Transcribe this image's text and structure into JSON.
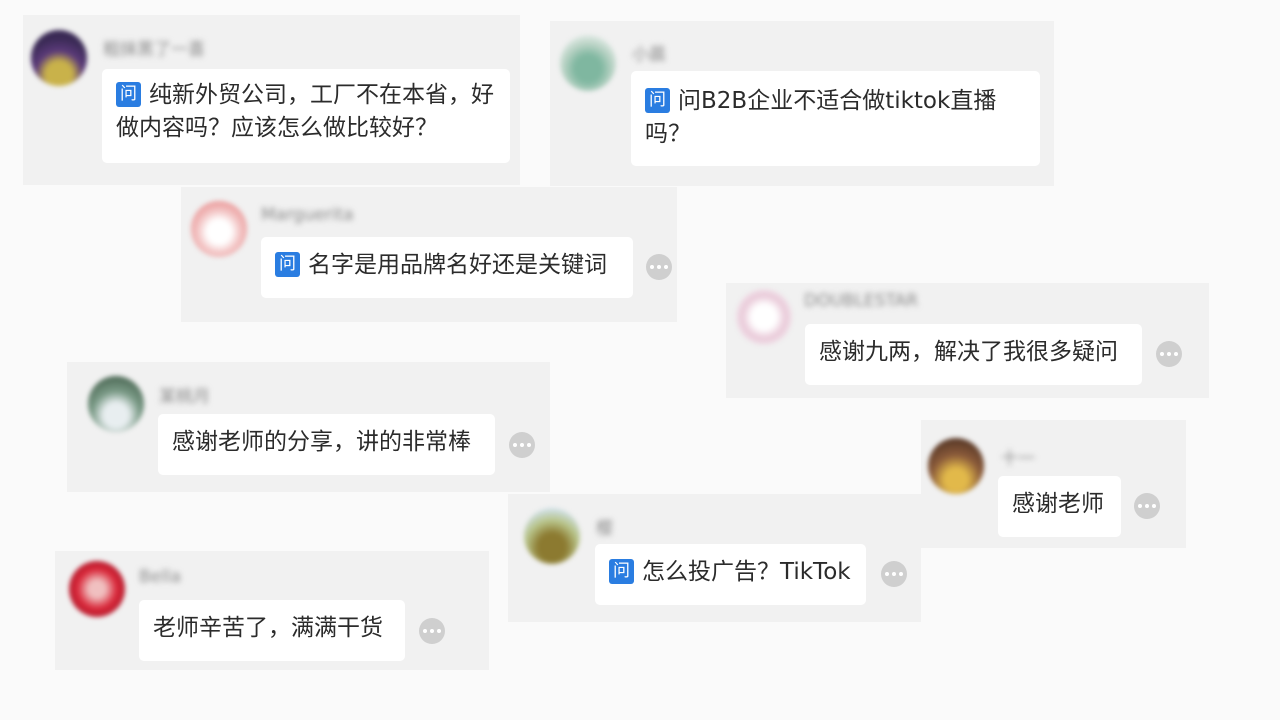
{
  "badge_label": "问",
  "comments": [
    {
      "username": "粗抹黑了一喜",
      "text": "纯新外贸公司，工厂不在本省，好做内容吗？应该怎么做比较好？",
      "is_question": true
    },
    {
      "username": "小晨",
      "text": "问B2B企业不适合做tiktok直播吗？",
      "is_question": false
    },
    {
      "username": "Marguerita",
      "text": "名字是用品牌名好还是关键词",
      "is_question": true
    },
    {
      "username": "DOUBLESTAR",
      "text": "感谢九两，解决了我很多疑问",
      "is_question": false
    },
    {
      "username": "某桃月",
      "text": "感谢老师的分享，讲的非常棒",
      "is_question": false
    },
    {
      "username": "十一",
      "text": "感谢老师",
      "is_question": false
    },
    {
      "username": "樱",
      "text": "怎么投广告？TikTok",
      "is_question": true
    },
    {
      "username": "Bella",
      "text": "老师辛苦了，满满干货",
      "is_question": false
    }
  ],
  "colors": {
    "badge": "#2a7de1",
    "card": "#f1f1f1",
    "bubble": "#ffffff"
  }
}
